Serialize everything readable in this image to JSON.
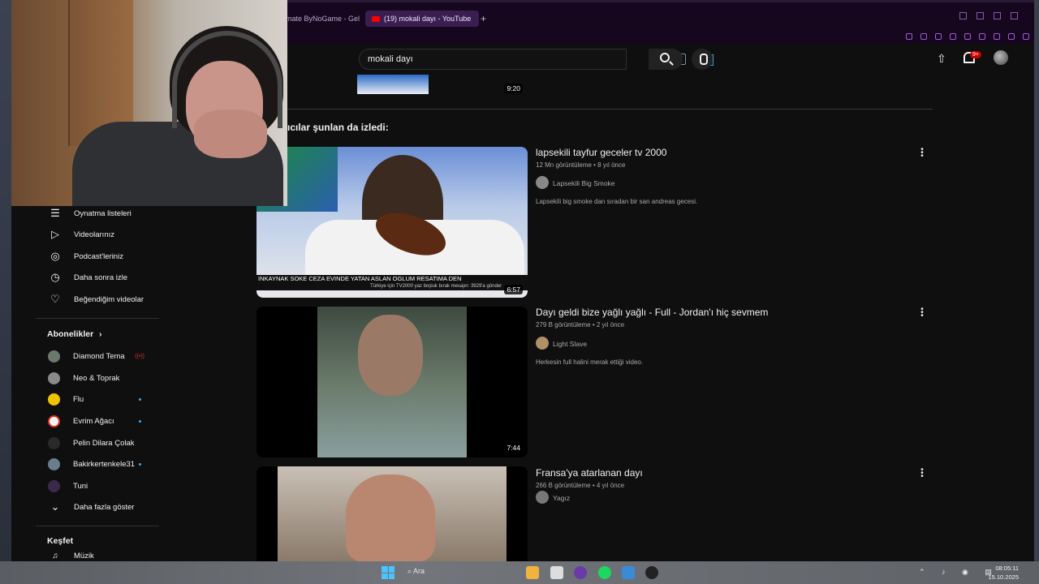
{
  "browser": {
    "tabs": [
      {
        "label": "mate ByNoGame - Gel"
      },
      {
        "label": "(19) mokali dayı - YouTube"
      }
    ],
    "new_tab": "+"
  },
  "header": {
    "search_value": "mokali dayı",
    "notification_badge": "9+"
  },
  "previous": {
    "duration": "9:20"
  },
  "section_title": "ıcılar şunlan da izledi:",
  "videos": [
    {
      "title": "lapsekili tayfur geceler tv 2000",
      "meta": "12 Mn görüntüleme • 8 yıl önce",
      "channel": "Lapsekili Big Smoke",
      "description": "Lapsekili big smoke dan sıradan bir san andreas gecesi.",
      "duration": "6:57",
      "thumb_caption": "INKAYNAK SOKE CEZA EVINDE YATAN ASLAN OGLUM RESATIMA DEN",
      "thumb_subcaption": "Türkiye için TV2000 yaz boşluk bırak mesajın: 3929'a gönder"
    },
    {
      "title": "Dayı geldi bize yağlı yağlı - Full - Jordan'ı hiç sevmem",
      "meta": "279 B görüntüleme • 2 yıl önce",
      "channel": "Light Slave",
      "description": "Herkesin full halini merak ettiği video.",
      "duration": "7:44"
    },
    {
      "title": "Fransa'ya atarlanan dayı",
      "meta": "266 B görüntüleme • 4 yıl önce",
      "channel": "Yagız"
    }
  ],
  "sidebar": {
    "items": [
      {
        "label": "Oynatma listeleri",
        "icon": "playlist-icon"
      },
      {
        "label": "Videolarınız",
        "icon": "video-icon"
      },
      {
        "label": "Podcast'leriniz",
        "icon": "podcast-icon"
      },
      {
        "label": "Daha sonra izle",
        "icon": "clock-icon"
      },
      {
        "label": "Beğendiğim videolar",
        "icon": "thumbs-up-icon"
      }
    ],
    "subscriptions_title": "Abonelikler",
    "subscriptions": [
      {
        "label": "Diamond Tema",
        "live": "((•))"
      },
      {
        "label": "Neo & Toprak"
      },
      {
        "label": "Flu"
      },
      {
        "label": "Evrim Ağacı"
      },
      {
        "label": "Pelin Dilara Çolak"
      },
      {
        "label": "Bakirkertenkele31"
      },
      {
        "label": "Tuni"
      }
    ],
    "show_more": "Daha fazla göster",
    "explore_title": "Keşfet",
    "explore_first": "Müzik"
  },
  "taskbar": {
    "search_label": "Ara",
    "time": "08:05:11",
    "date": "15.10.2025"
  },
  "colors": {
    "accent_purple": "#3a1e52",
    "yt_red": "#ff0000",
    "link_blue": "#3ea6ff"
  }
}
